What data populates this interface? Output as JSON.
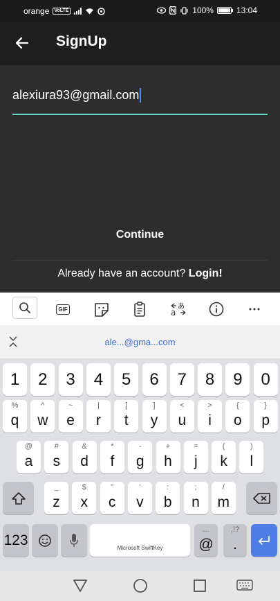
{
  "status_bar": {
    "carrier": "orange",
    "volte": "VoLTE",
    "battery": "100%",
    "time": "13:04"
  },
  "app_bar": {
    "title": "SignUp"
  },
  "form": {
    "email_value": "alexiura93@gmail.com",
    "continue_label": "Continue",
    "login_prompt": "Already have an account? ",
    "login_link": "Login!"
  },
  "keyboard": {
    "toolbar": {
      "icons": [
        "search-icon",
        "gif-icon",
        "sticker-icon",
        "clipboard-icon",
        "translate-icon",
        "info-icon",
        "more-icon"
      ],
      "gif_label": "GIF"
    },
    "suggestion": "ale...@gma...com",
    "number_row": [
      "1",
      "2",
      "3",
      "4",
      "5",
      "6",
      "7",
      "8",
      "9",
      "0"
    ],
    "row1": [
      {
        "k": "q",
        "s": "%"
      },
      {
        "k": "w",
        "s": "^"
      },
      {
        "k": "e",
        "s": "~"
      },
      {
        "k": "r",
        "s": "|"
      },
      {
        "k": "t",
        "s": "["
      },
      {
        "k": "y",
        "s": "]"
      },
      {
        "k": "u",
        "s": "<"
      },
      {
        "k": "i",
        "s": ">"
      },
      {
        "k": "o",
        "s": "{"
      },
      {
        "k": "p",
        "s": "}"
      }
    ],
    "row2": [
      {
        "k": "a",
        "s": "@"
      },
      {
        "k": "s",
        "s": "#"
      },
      {
        "k": "d",
        "s": "&"
      },
      {
        "k": "f",
        "s": "*"
      },
      {
        "k": "g",
        "s": "-"
      },
      {
        "k": "h",
        "s": "+"
      },
      {
        "k": "j",
        "s": "="
      },
      {
        "k": "k",
        "s": "("
      },
      {
        "k": "l",
        "s": ")"
      }
    ],
    "row3": [
      {
        "k": "z",
        "s": "_"
      },
      {
        "k": "x",
        "s": "$"
      },
      {
        "k": "c",
        "s": "\""
      },
      {
        "k": "v",
        "s": "'"
      },
      {
        "k": "b",
        "s": ":"
      },
      {
        "k": "n",
        "s": ";"
      },
      {
        "k": "m",
        "s": "/"
      }
    ],
    "numbers_key": "123",
    "space_label": "Microsoft SwiftKey",
    "at_key": "@",
    "at_sub": "...",
    "dot_key": ".",
    "dot_sub": ",!?",
    "accent_color": "#4f7ee6"
  }
}
